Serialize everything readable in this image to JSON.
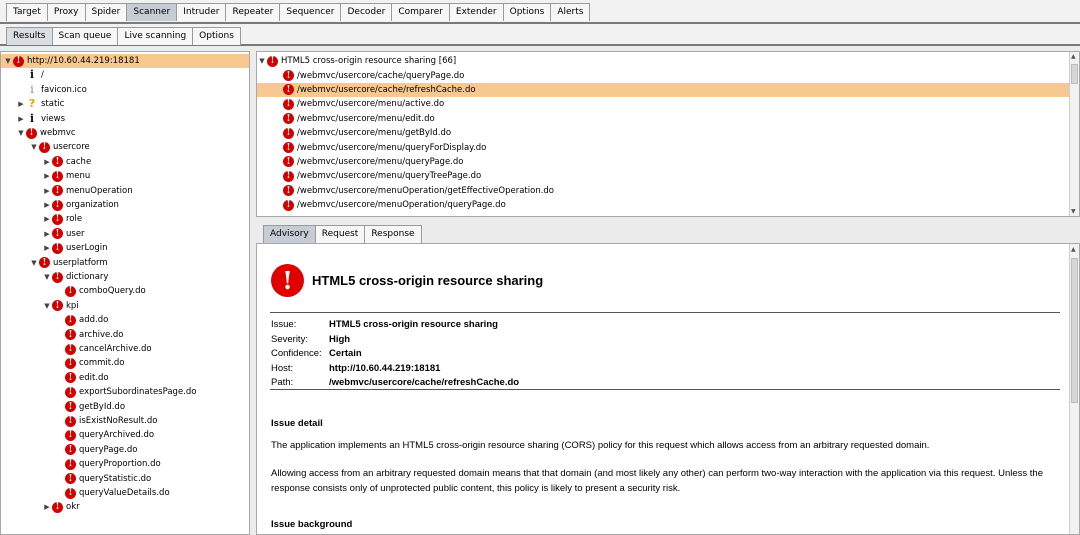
{
  "top_tabs": [
    "Target",
    "Proxy",
    "Spider",
    "Scanner",
    "Intruder",
    "Repeater",
    "Sequencer",
    "Decoder",
    "Comparer",
    "Extender",
    "Options",
    "Alerts"
  ],
  "active_top_tab": "Scanner",
  "sub_tabs": [
    "Results",
    "Scan queue",
    "Live scanning",
    "Options"
  ],
  "active_sub_tab": "Results",
  "tree": [
    {
      "label": "http://10.60.44.219:18181",
      "depth": 0,
      "icon": "red-alert-icon",
      "twisty": "down",
      "selected": true
    },
    {
      "label": "/",
      "depth": 1,
      "icon": "info-icon",
      "twisty": ""
    },
    {
      "label": "favicon.ico",
      "depth": 1,
      "icon": "info-light-icon",
      "twisty": ""
    },
    {
      "label": "static",
      "depth": 1,
      "icon": "question-icon",
      "twisty": "right"
    },
    {
      "label": "views",
      "depth": 1,
      "icon": "info-icon",
      "twisty": "right"
    },
    {
      "label": "webmvc",
      "depth": 1,
      "icon": "red-alert-icon",
      "twisty": "down"
    },
    {
      "label": "usercore",
      "depth": 2,
      "icon": "red-alert-icon",
      "twisty": "down"
    },
    {
      "label": "cache",
      "depth": 3,
      "icon": "red-alert-icon",
      "twisty": "right"
    },
    {
      "label": "menu",
      "depth": 3,
      "icon": "red-alert-icon",
      "twisty": "right"
    },
    {
      "label": "menuOperation",
      "depth": 3,
      "icon": "red-alert-icon",
      "twisty": "right"
    },
    {
      "label": "organization",
      "depth": 3,
      "icon": "red-alert-icon",
      "twisty": "right"
    },
    {
      "label": "role",
      "depth": 3,
      "icon": "red-alert-icon",
      "twisty": "right"
    },
    {
      "label": "user",
      "depth": 3,
      "icon": "red-alert-icon",
      "twisty": "right"
    },
    {
      "label": "userLogin",
      "depth": 3,
      "icon": "red-alert-icon",
      "twisty": "right"
    },
    {
      "label": "userplatform",
      "depth": 2,
      "icon": "red-alert-icon",
      "twisty": "down"
    },
    {
      "label": "dictionary",
      "depth": 3,
      "icon": "red-alert-icon",
      "twisty": "down"
    },
    {
      "label": "comboQuery.do",
      "depth": 4,
      "icon": "red-alert-icon",
      "twisty": ""
    },
    {
      "label": "kpi",
      "depth": 3,
      "icon": "red-alert-icon",
      "twisty": "down"
    },
    {
      "label": "add.do",
      "depth": 4,
      "icon": "red-alert-icon",
      "twisty": ""
    },
    {
      "label": "archive.do",
      "depth": 4,
      "icon": "red-alert-icon",
      "twisty": ""
    },
    {
      "label": "cancelArchive.do",
      "depth": 4,
      "icon": "red-alert-icon",
      "twisty": ""
    },
    {
      "label": "commit.do",
      "depth": 4,
      "icon": "red-alert-icon",
      "twisty": ""
    },
    {
      "label": "edit.do",
      "depth": 4,
      "icon": "red-alert-icon",
      "twisty": ""
    },
    {
      "label": "exportSubordinatesPage.do",
      "depth": 4,
      "icon": "red-alert-icon",
      "twisty": ""
    },
    {
      "label": "getById.do",
      "depth": 4,
      "icon": "red-alert-icon",
      "twisty": ""
    },
    {
      "label": "isExistNoResult.do",
      "depth": 4,
      "icon": "red-alert-icon",
      "twisty": ""
    },
    {
      "label": "queryArchived.do",
      "depth": 4,
      "icon": "red-alert-icon",
      "twisty": ""
    },
    {
      "label": "queryPage.do",
      "depth": 4,
      "icon": "red-alert-icon",
      "twisty": ""
    },
    {
      "label": "queryProportion.do",
      "depth": 4,
      "icon": "red-alert-icon",
      "twisty": ""
    },
    {
      "label": "queryStatistic.do",
      "depth": 4,
      "icon": "red-alert-icon",
      "twisty": ""
    },
    {
      "label": "queryValueDetails.do",
      "depth": 4,
      "icon": "red-alert-icon",
      "twisty": ""
    },
    {
      "label": "okr",
      "depth": 3,
      "icon": "red-alert-icon",
      "twisty": "right"
    }
  ],
  "issue_group": {
    "label": "HTML5 cross-origin resource sharing [66]"
  },
  "issue_items": [
    {
      "label": "/webmvc/usercore/cache/queryPage.do",
      "selected": false
    },
    {
      "label": "/webmvc/usercore/cache/refreshCache.do",
      "selected": true
    },
    {
      "label": "/webmvc/usercore/menu/active.do",
      "selected": false
    },
    {
      "label": "/webmvc/usercore/menu/edit.do",
      "selected": false
    },
    {
      "label": "/webmvc/usercore/menu/getById.do",
      "selected": false
    },
    {
      "label": "/webmvc/usercore/menu/queryForDisplay.do",
      "selected": false
    },
    {
      "label": "/webmvc/usercore/menu/queryPage.do",
      "selected": false
    },
    {
      "label": "/webmvc/usercore/menu/queryTreePage.do",
      "selected": false
    },
    {
      "label": "/webmvc/usercore/menuOperation/getEffectiveOperation.do",
      "selected": false
    },
    {
      "label": "/webmvc/usercore/menuOperation/queryPage.do",
      "selected": false
    }
  ],
  "detail_tabs": [
    "Advisory",
    "Request",
    "Response"
  ],
  "active_detail_tab": "Advisory",
  "advisory": {
    "title": "HTML5 cross-origin resource sharing",
    "fields": [
      {
        "key": "Issue:",
        "value": "HTML5 cross-origin resource sharing"
      },
      {
        "key": "Severity:",
        "value": "High"
      },
      {
        "key": "Confidence:",
        "value": "Certain"
      },
      {
        "key": "Host:",
        "value": "http://10.60.44.219:18181"
      },
      {
        "key": "Path:",
        "value": "/webmvc/usercore/cache/refreshCache.do"
      }
    ],
    "issue_detail_heading": "Issue detail",
    "issue_detail_p1": "The application implements an HTML5 cross-origin resource sharing (CORS) policy for this request which allows access from an arbitrary requested domain.",
    "issue_detail_p2": "Allowing access from an arbitrary requested domain means that that domain (and most likely any other) can perform two-way interaction with the application via this request. Unless the response consists only of unprotected public content, this policy is likely to present a security risk.",
    "issue_background_heading": "Issue background"
  },
  "colors": {
    "selection": "#f7c88f",
    "alert_red": "#d40000",
    "active_tab": "#c6ccd6"
  }
}
